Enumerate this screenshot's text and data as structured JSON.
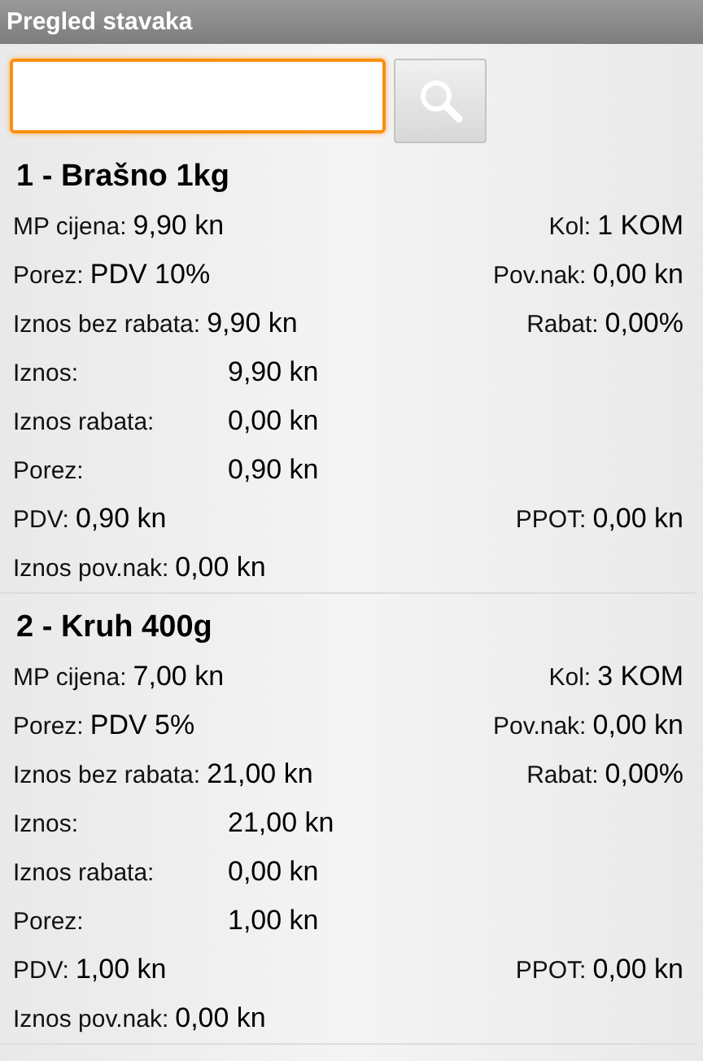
{
  "window": {
    "title": "Pregled stavaka"
  },
  "items": [
    {
      "title": "1 - Brašno 1kg",
      "rows": [
        {
          "kind": "pair",
          "left": {
            "label": "MP cijena:",
            "value": "9,90 kn"
          },
          "right": {
            "label": "Kol:",
            "value": "1 KOM"
          }
        },
        {
          "kind": "pair",
          "left": {
            "label": "Porez:",
            "value": "PDV 10%"
          },
          "right": {
            "label": "Pov.nak:",
            "value": "0,00 kn"
          }
        },
        {
          "kind": "pair",
          "left": {
            "label": "Iznos bez rabata:",
            "value": "9,90 kn"
          },
          "right": {
            "label": "Rabat:",
            "value": "0,00%"
          }
        },
        {
          "kind": "column",
          "left": {
            "label": "Iznos:",
            "value": "9,90 kn"
          }
        },
        {
          "kind": "column",
          "left": {
            "label": "Iznos rabata:",
            "value": "0,00 kn"
          }
        },
        {
          "kind": "column",
          "left": {
            "label": "Porez:",
            "value": "0,90 kn"
          }
        },
        {
          "kind": "pair",
          "left": {
            "label": "PDV:",
            "value": "0,90 kn"
          },
          "right": {
            "label": "PPOT:",
            "value": "0,00 kn"
          }
        },
        {
          "kind": "single",
          "left": {
            "label": "Iznos pov.nak:",
            "value": "0,00 kn"
          }
        }
      ]
    },
    {
      "title": "2 - Kruh 400g",
      "rows": [
        {
          "kind": "pair",
          "left": {
            "label": "MP cijena:",
            "value": "7,00 kn"
          },
          "right": {
            "label": "Kol:",
            "value": "3 KOM"
          }
        },
        {
          "kind": "pair",
          "left": {
            "label": "Porez:",
            "value": "PDV 5%"
          },
          "right": {
            "label": "Pov.nak:",
            "value": "0,00 kn"
          }
        },
        {
          "kind": "pair",
          "left": {
            "label": "Iznos bez rabata:",
            "value": "21,00 kn"
          },
          "right": {
            "label": "Rabat:",
            "value": "0,00%"
          }
        },
        {
          "kind": "column",
          "left": {
            "label": "Iznos:",
            "value": "21,00 kn"
          }
        },
        {
          "kind": "column",
          "left": {
            "label": "Iznos rabata:",
            "value": "0,00 kn"
          }
        },
        {
          "kind": "column",
          "left": {
            "label": "Porez:",
            "value": "1,00 kn"
          }
        },
        {
          "kind": "pair",
          "left": {
            "label": "PDV:",
            "value": "1,00 kn"
          },
          "right": {
            "label": "PPOT:",
            "value": "0,00 kn"
          }
        },
        {
          "kind": "single",
          "left": {
            "label": "Iznos pov.nak:",
            "value": "0,00 kn"
          }
        }
      ]
    }
  ]
}
